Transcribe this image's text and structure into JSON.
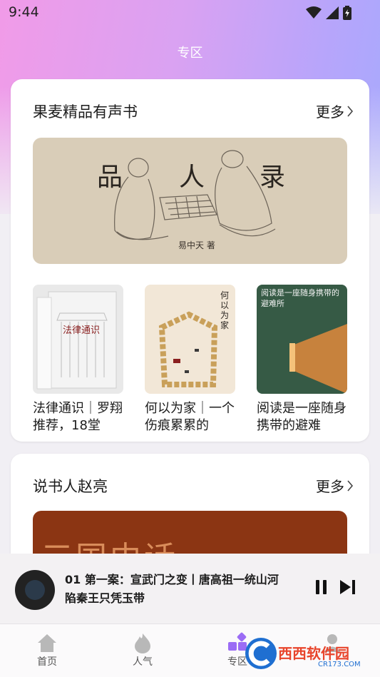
{
  "status": {
    "time": "9:44"
  },
  "page": {
    "title": "专区"
  },
  "section1": {
    "title": "果麦精品有声书",
    "more": "更多",
    "banner": {
      "chars": [
        "品",
        "人",
        "录"
      ],
      "author": "易中天 著"
    },
    "books": [
      {
        "title": "法律通识｜罗翔推荐，18堂",
        "cover_text": "法律通识"
      },
      {
        "title": "何以为家｜一个伤痕累累的",
        "cover_text": "何以为家"
      },
      {
        "title": "阅读是一座随身携带的避难",
        "cover_text": "阅读是一座随身携带的避难所"
      }
    ]
  },
  "section2": {
    "title": "说书人赵亮",
    "more": "更多",
    "banner_text": "三国中话"
  },
  "player": {
    "title": "01 第一案：宣武门之变丨唐高祖一统山河 陷秦王只凭玉带"
  },
  "tabs": [
    {
      "label": "首页",
      "icon": "home-icon"
    },
    {
      "label": "人气",
      "icon": "flame-icon"
    },
    {
      "label": "专区",
      "icon": "grid-icon",
      "active": true
    },
    {
      "label": "",
      "icon": "profile-icon"
    }
  ],
  "watermark": {
    "text": "西西软件园",
    "sub": "CR173.COM"
  },
  "colors": {
    "accent": "#9b6cf5",
    "gradient_start": "#f19be8",
    "gradient_end": "#a7a9fd"
  }
}
